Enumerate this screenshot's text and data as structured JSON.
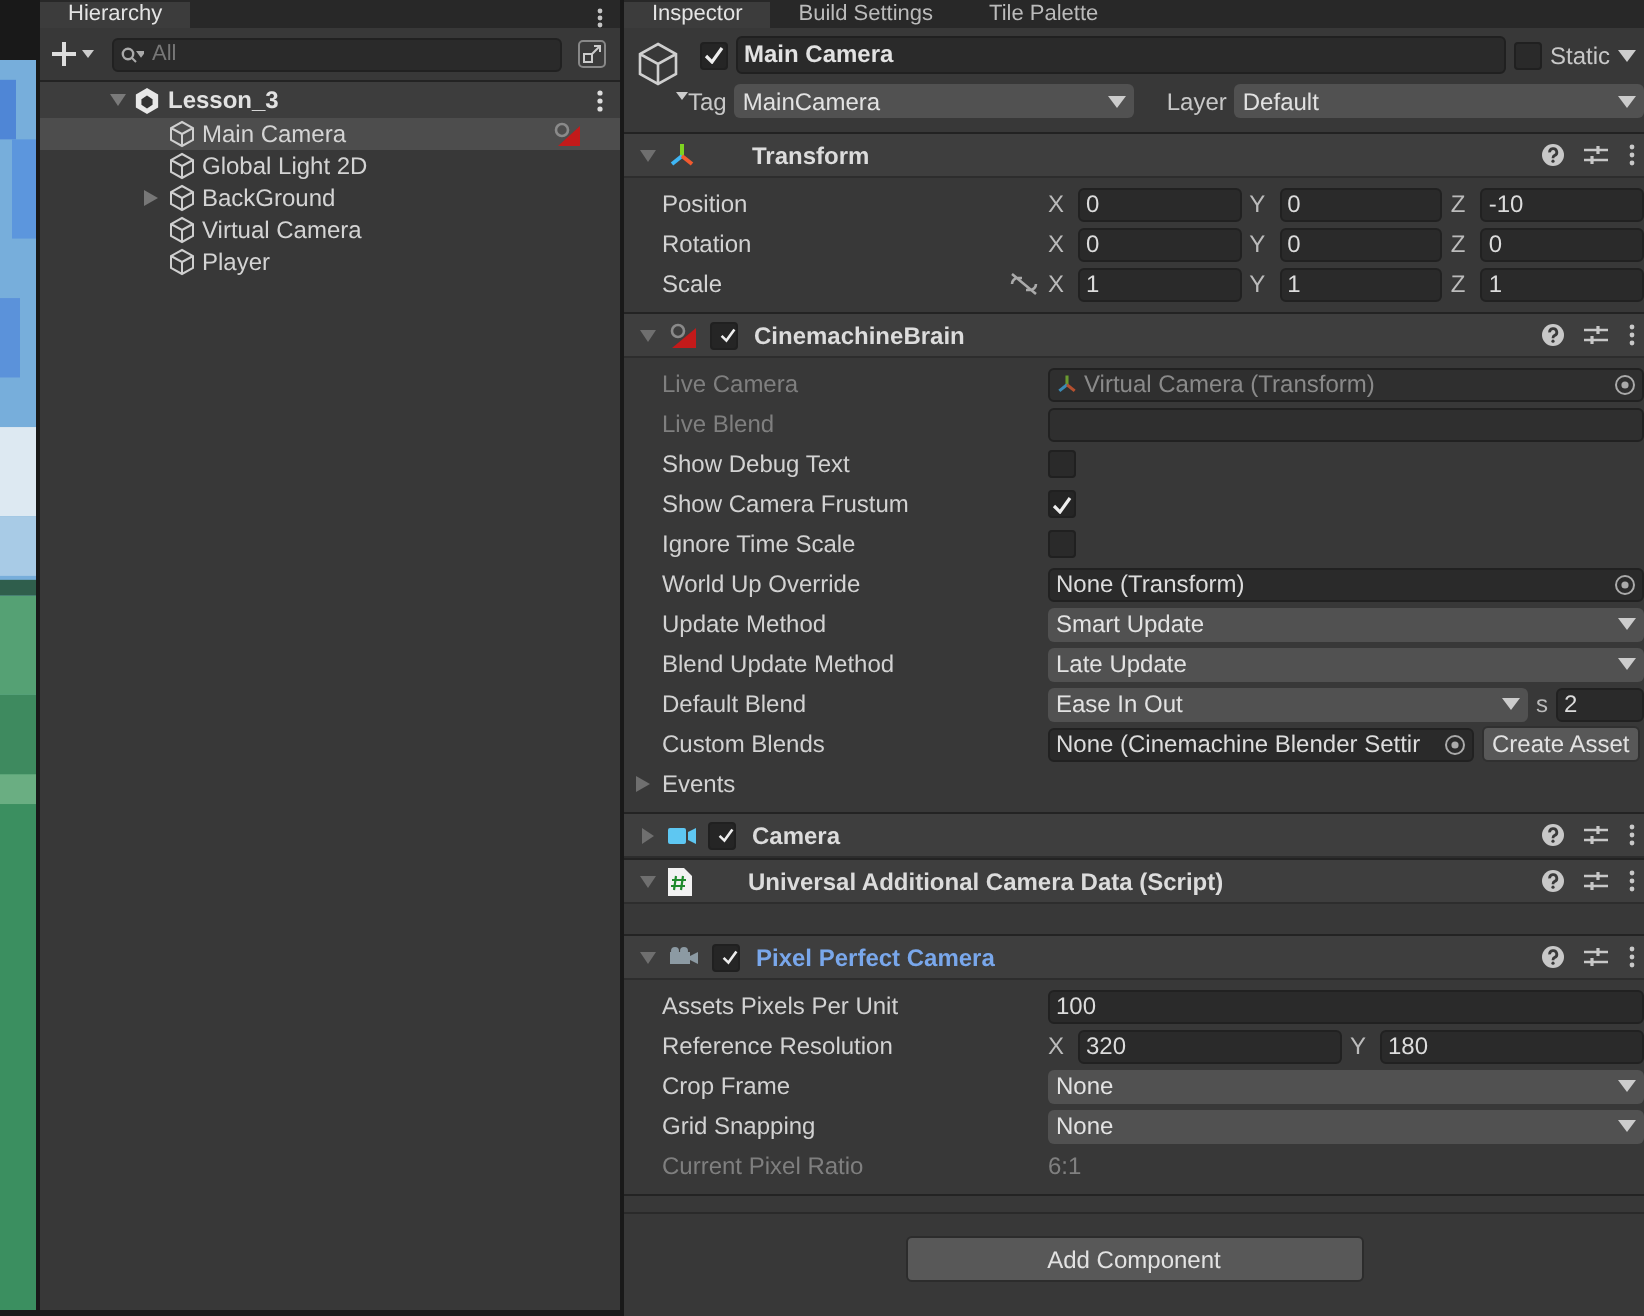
{
  "hierarchy_tabs": [
    {
      "label": "Hierarchy",
      "selected": true
    }
  ],
  "inspector_tabs": [
    {
      "label": "Inspector",
      "selected": true
    },
    {
      "label": "Build Settings",
      "selected": false
    },
    {
      "label": "Tile Palette",
      "selected": false
    }
  ],
  "hierarchy": {
    "search": {
      "placeholder": "All"
    },
    "scene": {
      "name": "Lesson_3",
      "expanded": true,
      "children": [
        {
          "name": "Main Camera",
          "selected": true,
          "expandable": false,
          "brain_badge": true
        },
        {
          "name": "Global Light 2D",
          "selected": false,
          "expandable": false,
          "brain_badge": false
        },
        {
          "name": "BackGround",
          "selected": false,
          "expandable": true,
          "brain_badge": false
        },
        {
          "name": "Virtual Camera",
          "selected": false,
          "expandable": false,
          "brain_badge": false
        },
        {
          "name": "Player",
          "selected": false,
          "expandable": false,
          "brain_badge": false
        }
      ]
    }
  },
  "object": {
    "active": true,
    "name": "Main Camera",
    "static": false,
    "static_label": "Static",
    "tag_label": "Tag",
    "tag": "MainCamera",
    "layer_label": "Layer",
    "layer": "Default"
  },
  "components": [
    {
      "kind": "transform",
      "title": "Transform",
      "expanded": true,
      "highlighted": false,
      "rows": [
        {
          "kind": "vector",
          "label": "Position",
          "disabled": false,
          "constrained": false,
          "fields": [
            {
              "axis": "X",
              "value": "0"
            },
            {
              "axis": "Y",
              "value": "0"
            },
            {
              "axis": "Z",
              "value": "-10"
            }
          ]
        },
        {
          "kind": "vector",
          "label": "Rotation",
          "disabled": false,
          "constrained": false,
          "fields": [
            {
              "axis": "X",
              "value": "0"
            },
            {
              "axis": "Y",
              "value": "0"
            },
            {
              "axis": "Z",
              "value": "0"
            }
          ]
        },
        {
          "kind": "vector",
          "label": "Scale",
          "disabled": false,
          "constrained": true,
          "fields": [
            {
              "axis": "X",
              "value": "1"
            },
            {
              "axis": "Y",
              "value": "1"
            },
            {
              "axis": "Z",
              "value": "1"
            }
          ]
        }
      ]
    },
    {
      "kind": "brain",
      "title": "CinemachineBrain",
      "enabled": true,
      "expanded": true,
      "highlighted": false,
      "rows": [
        {
          "kind": "object",
          "label": "Live Camera",
          "disabled": true,
          "has_icon": true,
          "value": "Virtual Camera (Transform)"
        },
        {
          "kind": "blank",
          "label": "Live Blend",
          "disabled": true
        },
        {
          "kind": "checkbox",
          "label": "Show Debug Text",
          "disabled": false,
          "checked": false
        },
        {
          "kind": "checkbox",
          "label": "Show Camera Frustum",
          "disabled": false,
          "checked": true
        },
        {
          "kind": "checkbox",
          "label": "Ignore Time Scale",
          "disabled": false,
          "checked": false
        },
        {
          "kind": "object",
          "label": "World Up Override",
          "disabled": false,
          "has_icon": false,
          "value": "None (Transform)"
        },
        {
          "kind": "dropdown",
          "label": "Update Method",
          "disabled": false,
          "value": "Smart Update"
        },
        {
          "kind": "dropdown",
          "label": "Blend Update Method",
          "disabled": false,
          "value": "Late Update"
        },
        {
          "kind": "blend",
          "label": "Default Blend",
          "disabled": false,
          "value": "Ease In Out",
          "unit": "s",
          "number": "2"
        },
        {
          "kind": "asset",
          "label": "Custom Blends",
          "disabled": false,
          "value": "None (Cinemachine Blender Settir",
          "button": "Create Asset"
        },
        {
          "kind": "foldout",
          "label": "Events",
          "disabled": false,
          "expanded": false
        }
      ]
    },
    {
      "kind": "camera",
      "title": "Camera",
      "enabled": true,
      "expanded": false,
      "highlighted": false
    },
    {
      "kind": "script",
      "title": "Universal Additional Camera Data (Script)",
      "expanded": true,
      "highlighted": false
    },
    {
      "kind": "pixel",
      "title": "Pixel Perfect Camera",
      "enabled": true,
      "expanded": true,
      "highlighted": true,
      "rows": [
        {
          "kind": "text",
          "label": "Assets Pixels Per Unit",
          "disabled": false,
          "value": "100"
        },
        {
          "kind": "vector",
          "label": "Reference Resolution",
          "disabled": false,
          "constrained": false,
          "fields": [
            {
              "axis": "X",
              "value": "320"
            },
            {
              "axis": "Y",
              "value": "180"
            }
          ]
        },
        {
          "kind": "dropdown",
          "label": "Crop Frame",
          "disabled": false,
          "value": "None"
        },
        {
          "kind": "dropdown",
          "label": "Grid Snapping",
          "disabled": false,
          "value": "None"
        },
        {
          "kind": "readonly",
          "label": "Current Pixel Ratio",
          "disabled": true,
          "value": "6:1"
        }
      ]
    }
  ],
  "add_component": "Add Component"
}
